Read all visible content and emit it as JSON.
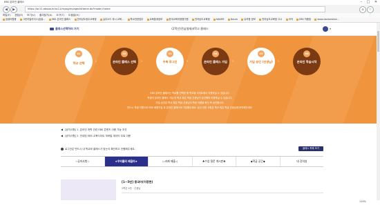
{
  "browser": {
    "tab_title": "EBS 온라인 클래스",
    "url": "https://oc11.ebssw.kr/oc11/mypg/myageclsHome.do?mode=home",
    "window_controls": [
      "–",
      "□",
      "✕"
    ],
    "menu": [
      "파일(F)",
      "편집(E)",
      "보기(V)",
      "즐겨찾기(A)",
      "도구(T)",
      "도움말(H)"
    ],
    "favorites": [
      "컴퓨터활용",
      "그린아일라이스(컴퓨...",
      "EBS 온라인 클래스",
      "전라남도광주교육청",
      "실무소드 푸시 교육...",
      "학교관련업무",
      "교육통계정보",
      "한국교육과정평가원",
      "전라남도교육청",
      "NAVER",
      "Daum",
      "유치원 정보",
      "전라남도교육청 고시",
      "국악",
      "EBS 작품등",
      "www.doctorshed..."
    ]
  },
  "header": {
    "logo_text": "클래스선택하러 가기",
    "title": "(2학년)전남영재과학고 클래스"
  },
  "hero": {
    "steps": [
      {
        "num": "01",
        "label": "학교 선택",
        "style": "light"
      },
      {
        "num": "02",
        "label": "온라인 클래스 선택",
        "style": "dark"
      },
      {
        "num": "03",
        "label": "우측 로그인",
        "style": "light"
      },
      {
        "num": "04",
        "label": "온라인 클래스 가입",
        "style": "dark"
      },
      {
        "num": "05",
        "label": "가입 승인 (선생님)",
        "style": "light"
      },
      {
        "num": "06",
        "label": "온라인 학습시작",
        "style": "dark"
      }
    ],
    "desc": [
      "EBS 온라인 클래스는 학교를 선택한 후 학교별 사이트에서 이용하실 수 있습니다.",
      "학생이 온라인 클래스 가입 후 학교 혹은 학급 선생님이 승인해야 이용하실 수 있습니다.",
      "가입 승인은 학교 혹은 학급 선생님이 학생 이름을 확인 후 승인합니다.",
      "반드시 학생 이름으로 EBS 회원가입 후 온라인 클래스에 가입해주세요. 승인 관련 사항은 학교 혹은 학급 선생님께 문의해주세요."
    ]
  },
  "notices": [
    "[공지사항] 1. 온라인 개학 관련 EBS 콘텐츠 이용 가능 조건",
    "[공지사항] 2. 안내된 EBS 교육사이트 모바일 데이터 무료 이용"
  ],
  "warning": "로그인은 반드시 내 학교와 클래스가 맞는지 확인하고 진행해주세요.",
  "small_button": "클래스 목록 보기",
  "tabs": [
    {
      "label": "☆공지사항☆",
      "active": false
    },
    {
      "label": "★우리들의 배움터★",
      "active": true
    },
    {
      "label": "▷과제 제출◁",
      "active": false
    },
    {
      "label": "♣수업 질문 게시판♣",
      "active": false
    },
    {
      "label": "◆학급 공간◆",
      "active": false
    },
    {
      "label": "내 강의실",
      "active": false
    }
  ],
  "card": {
    "title": "[1~5반] 중국어(이정현)",
    "sub": "2학년 4반 · 선생님"
  },
  "status": {
    "zoom": "110%"
  }
}
